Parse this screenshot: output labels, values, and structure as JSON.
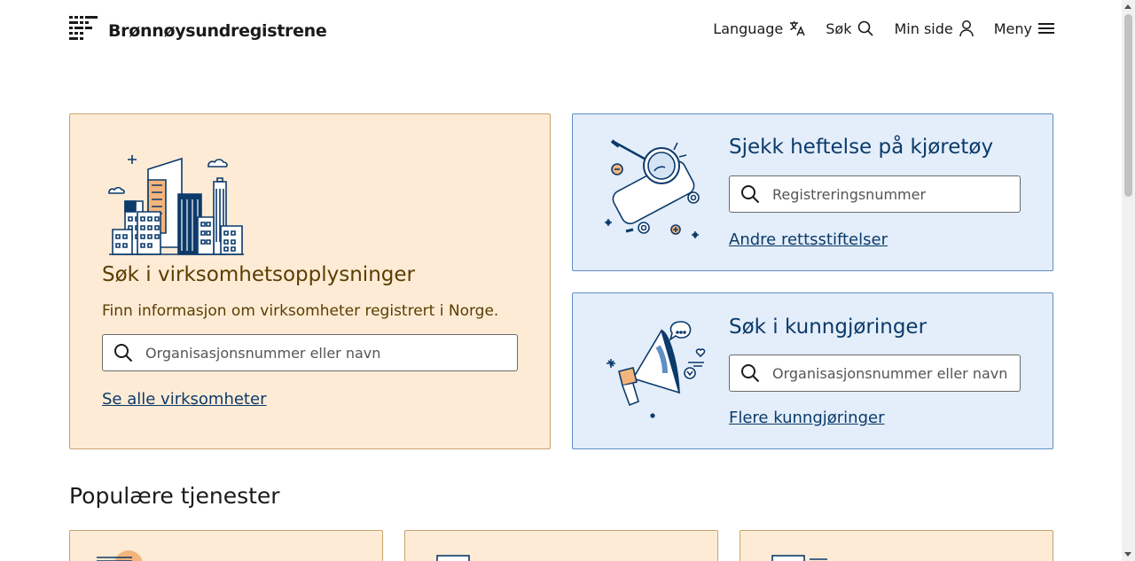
{
  "header": {
    "logo_text": "Brønnøysundregistrene",
    "nav": {
      "language": "Language",
      "search": "Søk",
      "my_page": "Min side",
      "menu": "Meny"
    }
  },
  "business_card": {
    "title": "Søk i virksomhetsopplysninger",
    "subtitle": "Finn informasjon om virksomheter registrert i Norge.",
    "search_placeholder": "Organisasjonsnummer eller navn",
    "link": "Se alle virksomheter"
  },
  "vehicle_card": {
    "title": "Sjekk heftelse på kjøretøy",
    "search_placeholder": "Registreringsnummer",
    "link": "Andre rettsstiftelser"
  },
  "announce_card": {
    "title": "Søk i kunngjøringer",
    "search_placeholder": "Organisasjonsnummer eller navn",
    "link": "Flere kunngjøringer"
  },
  "popular": {
    "title": "Populære tjenester"
  },
  "colors": {
    "orange_bg": "#fdebd5",
    "orange_border": "#c9a36e",
    "blue_bg": "#e3eefa",
    "blue_border": "#5f8fc4",
    "link": "#0c3a6a"
  }
}
